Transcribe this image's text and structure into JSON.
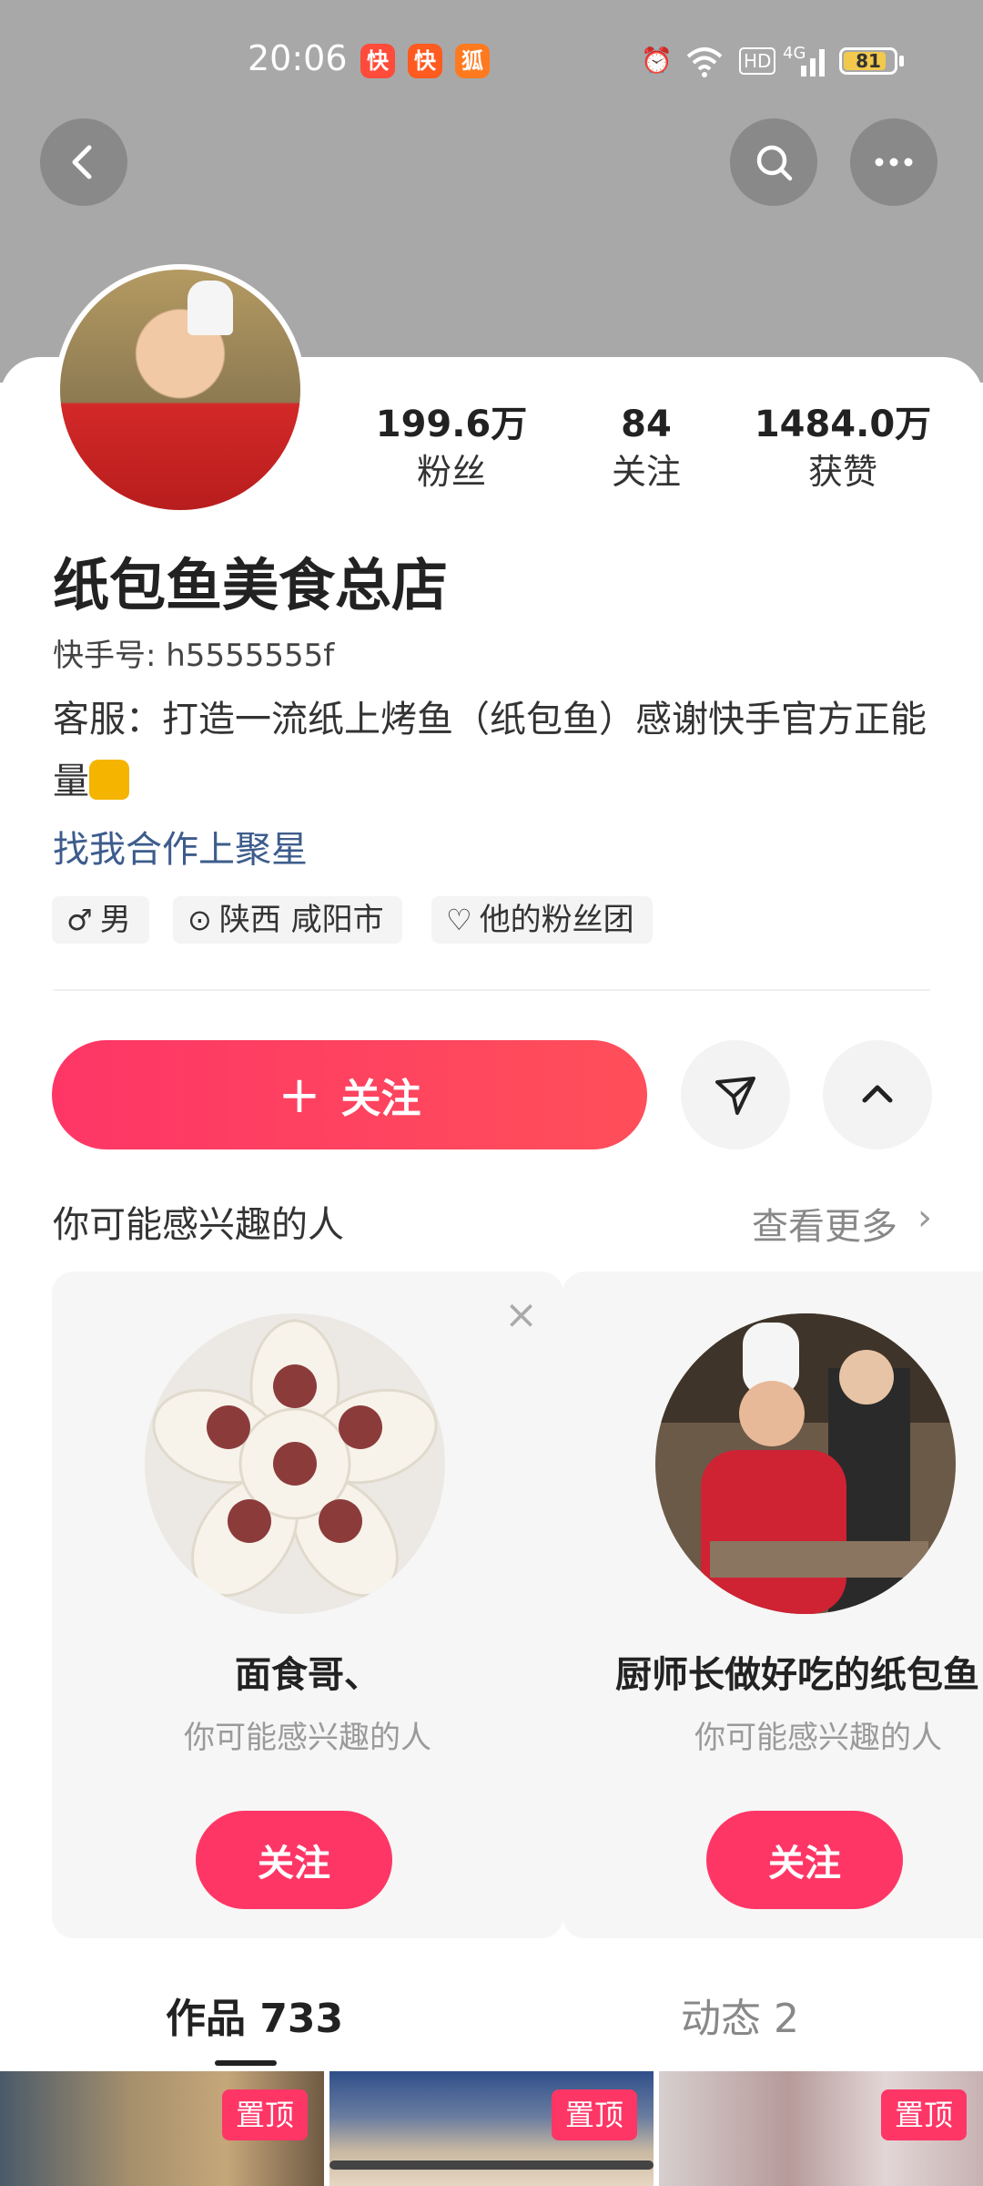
{
  "status_bar": {
    "time": "20:06",
    "notification_icons": [
      "kuaishou-app-icon",
      "kuaishou-app-icon",
      "kuaishou-fox-app-icon"
    ],
    "network": "4G",
    "hd_label": "HD",
    "battery": "81"
  },
  "top_actions": {
    "back_icon": "chevron-left-icon",
    "search_icon": "search-icon",
    "more_icon": "more-dots-icon"
  },
  "profile": {
    "stats": [
      {
        "value": "199.6万",
        "label": "粉丝"
      },
      {
        "value": "84",
        "label": "关注"
      },
      {
        "value": "1484.0万",
        "label": "获赞"
      }
    ],
    "name": "纸包鱼美食总店",
    "kuaishou_id": "快手号: h5555555f",
    "bio": "客服：打造一流纸上烤鱼（纸包鱼）感谢快手官方正能量",
    "bio_emoji": "thumbs-up-icon",
    "collab_link": "找我合作上聚星",
    "tags": [
      {
        "icon": "male-icon",
        "glyph": "♂",
        "label": "男"
      },
      {
        "icon": "location-icon",
        "glyph": "⊙",
        "label": "陕西 咸阳市"
      },
      {
        "icon": "heart-icon",
        "glyph": "♡",
        "label": "他的粉丝团"
      }
    ]
  },
  "actions": {
    "follow_plus": "+",
    "follow_label": "关注",
    "send_icon": "paper-plane-icon",
    "collapse_icon": "chevron-up-icon"
  },
  "recommend": {
    "title": "你可能感兴趣的人",
    "more_label": "查看更多",
    "more_arrow": "›",
    "cards": [
      {
        "name": "面食哥、",
        "subtitle": "你可能感兴趣的人",
        "follow_label": "关注",
        "close_glyph": "×"
      },
      {
        "name": "厨师长做好吃的纸包鱼",
        "subtitle": "你可能感兴趣的人",
        "follow_label": "关注"
      }
    ]
  },
  "tabs": [
    {
      "label": "作品 733",
      "active": true
    },
    {
      "label": "动态 2",
      "active": false
    }
  ],
  "grid": [
    {
      "badge": "置顶"
    },
    {
      "badge": "置顶"
    },
    {
      "badge": "置顶"
    }
  ]
}
